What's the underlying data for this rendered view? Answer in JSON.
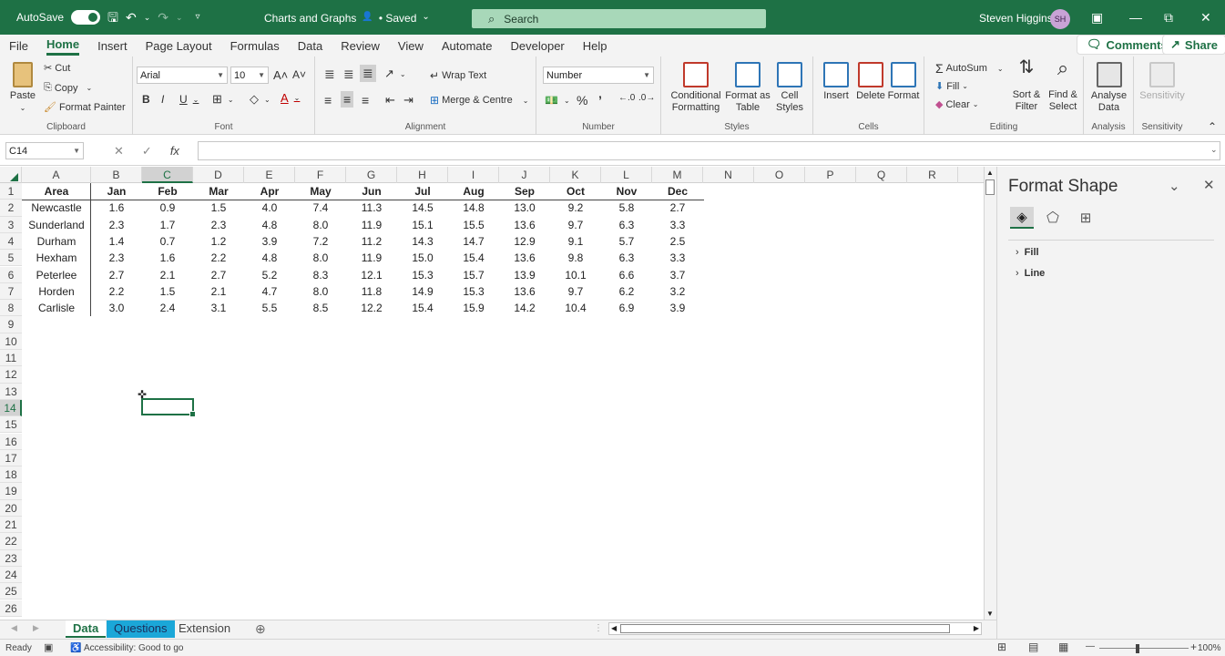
{
  "titlebar": {
    "autosave_label": "AutoSave",
    "doc_title": "Charts and Graphs",
    "saved_label": "• Saved",
    "search_placeholder": "Search",
    "user_name": "Steven Higgins",
    "user_initials": "SH"
  },
  "menu": {
    "tabs": [
      "File",
      "Home",
      "Insert",
      "Page Layout",
      "Formulas",
      "Data",
      "Review",
      "View",
      "Automate",
      "Developer",
      "Help"
    ],
    "active": "Home",
    "comments": "Comments",
    "share": "Share"
  },
  "ribbon": {
    "clipboard": {
      "label": "Clipboard",
      "paste": "Paste",
      "cut": "Cut",
      "copy": "Copy",
      "format_painter": "Format Painter"
    },
    "font": {
      "label": "Font",
      "family": "Arial",
      "size": "10"
    },
    "alignment": {
      "label": "Alignment",
      "wrap_text": "Wrap Text",
      "merge_centre": "Merge & Centre"
    },
    "number": {
      "label": "Number",
      "format": "Number"
    },
    "styles": {
      "label": "Styles",
      "conditional_1": "Conditional",
      "conditional_2": "Formatting",
      "format_table_1": "Format as",
      "format_table_2": "Table",
      "cell_styles_1": "Cell",
      "cell_styles_2": "Styles"
    },
    "cells": {
      "label": "Cells",
      "insert": "Insert",
      "delete": "Delete",
      "format": "Format"
    },
    "editing": {
      "label": "Editing",
      "autosum": "AutoSum",
      "fill": "Fill",
      "clear": "Clear",
      "sort_1": "Sort &",
      "sort_2": "Filter",
      "find_1": "Find &",
      "find_2": "Select"
    },
    "analysis": {
      "label": "Analysis",
      "analyse_1": "Analyse",
      "analyse_2": "Data"
    },
    "sensitivity": {
      "label": "Sensitivity",
      "btn": "Sensitivity"
    }
  },
  "formula_bar": {
    "name_box": "C14",
    "fx": "fx",
    "formula": ""
  },
  "grid": {
    "columns": [
      "A",
      "B",
      "C",
      "D",
      "E",
      "F",
      "G",
      "H",
      "I",
      "J",
      "K",
      "L",
      "M",
      "N",
      "O",
      "P",
      "Q",
      "R"
    ],
    "selected_column": "C",
    "rows": [
      "1",
      "2",
      "3",
      "4",
      "5",
      "6",
      "7",
      "8",
      "9",
      "10",
      "11",
      "12",
      "13",
      "14",
      "15",
      "16",
      "17",
      "18",
      "19",
      "20",
      "21",
      "22",
      "23",
      "24",
      "25",
      "26"
    ],
    "selected_row": "14",
    "header": [
      "Area",
      "Jan",
      "Feb",
      "Mar",
      "Apr",
      "May",
      "Jun",
      "Jul",
      "Aug",
      "Sep",
      "Oct",
      "Nov",
      "Dec"
    ],
    "data": [
      [
        "Newcastle",
        "1.6",
        "0.9",
        "1.5",
        "4.0",
        "7.4",
        "11.3",
        "14.5",
        "14.8",
        "13.0",
        "9.2",
        "5.8",
        "2.7"
      ],
      [
        "Sunderland",
        "2.3",
        "1.7",
        "2.3",
        "4.8",
        "8.0",
        "11.9",
        "15.1",
        "15.5",
        "13.6",
        "9.7",
        "6.3",
        "3.3"
      ],
      [
        "Durham",
        "1.4",
        "0.7",
        "1.2",
        "3.9",
        "7.2",
        "11.2",
        "14.3",
        "14.7",
        "12.9",
        "9.1",
        "5.7",
        "2.5"
      ],
      [
        "Hexham",
        "2.3",
        "1.6",
        "2.2",
        "4.8",
        "8.0",
        "11.9",
        "15.0",
        "15.4",
        "13.6",
        "9.8",
        "6.3",
        "3.3"
      ],
      [
        "Peterlee",
        "2.7",
        "2.1",
        "2.7",
        "5.2",
        "8.3",
        "12.1",
        "15.3",
        "15.7",
        "13.9",
        "10.1",
        "6.6",
        "3.7"
      ],
      [
        "Horden",
        "2.2",
        "1.5",
        "2.1",
        "4.7",
        "8.0",
        "11.8",
        "14.9",
        "15.3",
        "13.6",
        "9.7",
        "6.2",
        "3.2"
      ],
      [
        "Carlisle",
        "3.0",
        "2.4",
        "3.1",
        "5.5",
        "8.5",
        "12.2",
        "15.4",
        "15.9",
        "14.2",
        "10.4",
        "6.9",
        "3.9"
      ]
    ]
  },
  "sheets": [
    "Data",
    "Questions",
    "Extension"
  ],
  "active_sheet": "Data",
  "status": {
    "ready": "Ready",
    "accessibility": "Accessibility: Good to go",
    "zoom": "100%"
  },
  "pane": {
    "title": "Format Shape",
    "sections": [
      "Fill",
      "Line"
    ]
  },
  "colors": {
    "brand": "#1e7145",
    "sheet_highlight": "#1ba7d8"
  }
}
